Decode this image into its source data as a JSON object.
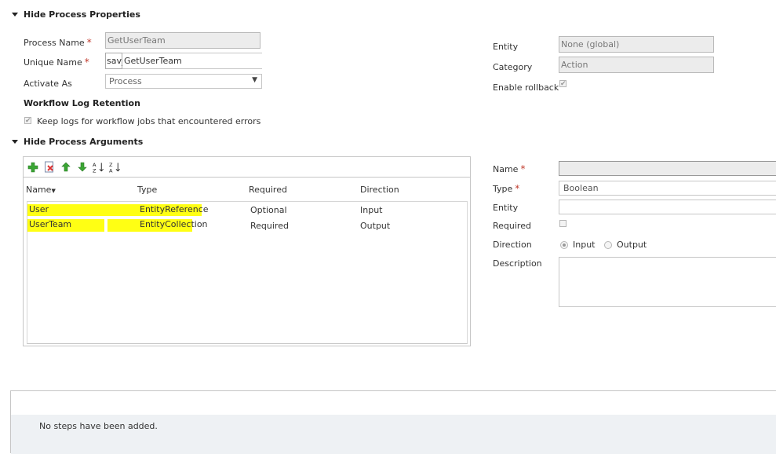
{
  "process_properties": {
    "header": "Hide Process Properties",
    "process_name_label": "Process Name",
    "process_name_value": "GetUserTeam",
    "unique_name_label": "Unique Name",
    "unique_name_prefix": "sav_",
    "unique_name_value": "GetUserTeam",
    "activate_as_label": "Activate As",
    "activate_as_value": "Process",
    "entity_label": "Entity",
    "entity_value": "None (global)",
    "category_label": "Category",
    "category_value": "Action",
    "enable_rollback_label": "Enable rollback",
    "log_retention_header": "Workflow Log Retention",
    "keep_logs_label": "Keep logs for workflow jobs that encountered errors"
  },
  "process_arguments": {
    "header": "Hide Process Arguments",
    "columns": [
      "Name",
      "Type",
      "Required",
      "Direction"
    ],
    "rows": [
      {
        "name": "User",
        "type": "EntityReference",
        "required": "Optional",
        "direction": "Input"
      },
      {
        "name": "UserTeam",
        "type": "EntityCollection",
        "required": "Required",
        "direction": "Output"
      }
    ],
    "toolbar_icons": [
      "add-icon",
      "delete-icon",
      "move-up-icon",
      "move-down-icon",
      "sort-ascending-icon",
      "sort-descending-icon"
    ]
  },
  "argument_details": {
    "name_label": "Name",
    "name_value": "",
    "type_label": "Type",
    "type_value": "Boolean",
    "entity_label": "Entity",
    "entity_value": "",
    "required_label": "Required",
    "direction_label": "Direction",
    "direction_input": "Input",
    "direction_output": "Output",
    "description_label": "Description",
    "description_value": ""
  },
  "steps": {
    "empty_message": "No steps have been added."
  },
  "colors": {
    "highlight": "#ffff14",
    "required_marker": "#c0392b",
    "readonly_bg": "#ececec"
  }
}
